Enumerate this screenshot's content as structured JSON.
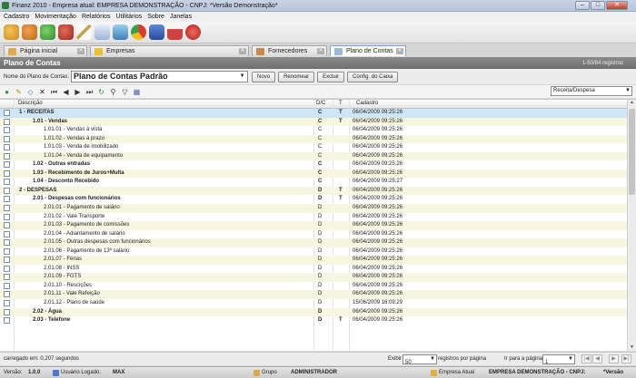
{
  "window": {
    "title": "Finanz 2010 - Empresa atual: EMPRESA DEMONSTRAÇÃO - CNPJ: *Versão Demonstração*",
    "minimize": "–",
    "maximize": "□",
    "close": "✕"
  },
  "menu": [
    "Cadastro",
    "Movimentação",
    "Relatórios",
    "Utilitários",
    "Sobre",
    "Janelas"
  ],
  "toolbar_icons": [
    "users-icon",
    "people-icon",
    "money-icon",
    "cash-icon",
    "pen-icon",
    "report-icon",
    "chart-icon",
    "pie-icon",
    "save-icon",
    "calendar-icon",
    "power-icon"
  ],
  "tabs": [
    {
      "label": "Página inicial",
      "icon": "home-icon",
      "active": false
    },
    {
      "label": "Empresas",
      "icon": "star-icon",
      "active": false
    },
    {
      "label": "Fornecedores",
      "icon": "box-icon",
      "active": false
    },
    {
      "label": "Plano de Contas",
      "icon": "document-icon",
      "active": true
    }
  ],
  "header": {
    "title": "Plano de Contas",
    "count": "1-50/84 registros"
  },
  "form": {
    "label": "Nome do Plano de Contas:",
    "value": "Plano de Contas Padrão",
    "buttons": [
      "Novo",
      "Renomear",
      "Excluir",
      "Config. do Caixa"
    ]
  },
  "actions": {
    "icons": [
      "add-icon",
      "edit-icon",
      "erase-icon",
      "delete-icon",
      "first-icon",
      "prev-icon",
      "next-icon",
      "last-icon",
      "refresh-icon",
      "search-icon",
      "filter-icon",
      "grid-icon"
    ],
    "type_select": "Receita/Despesa"
  },
  "grid": {
    "columns": {
      "descricao": "Descrição",
      "dc": "D/C",
      "t": "T",
      "cadastro": "Cadastro"
    },
    "rows": [
      {
        "desc": "1 - RECEITAS",
        "dc": "C",
        "t": "T",
        "cad": "06/04/2009 09:25:26",
        "level": 0
      },
      {
        "desc": "1.01 - Vendas",
        "dc": "C",
        "t": "T",
        "cad": "06/04/2009 09:25:26",
        "level": 1
      },
      {
        "desc": "1.01.01 - Vendas à vista",
        "dc": "C",
        "t": "",
        "cad": "06/04/2009 09:25:26",
        "level": 2
      },
      {
        "desc": "1.01.02 - Vendas à prazo",
        "dc": "C",
        "t": "",
        "cad": "06/04/2009 09:25:26",
        "level": 2
      },
      {
        "desc": "1.01.03 - Venda de imobilizado",
        "dc": "C",
        "t": "",
        "cad": "06/04/2009 09:25:26",
        "level": 2
      },
      {
        "desc": "1.01.04 - Venda de equipamento",
        "dc": "C",
        "t": "",
        "cad": "06/04/2009 09:25:26",
        "level": 2
      },
      {
        "desc": "1.02 - Outras entradas",
        "dc": "C",
        "t": "",
        "cad": "06/04/2009 09:25:26",
        "level": 1
      },
      {
        "desc": "1.03 - Recebimento de Juros+Multa",
        "dc": "C",
        "t": "",
        "cad": "06/04/2009 09:25:26",
        "level": 1
      },
      {
        "desc": "1.04 - Desconto Recebido",
        "dc": "C",
        "t": "",
        "cad": "06/04/2009 09:25:27",
        "level": 1
      },
      {
        "desc": "2 - DESPESAS",
        "dc": "D",
        "t": "T",
        "cad": "06/04/2009 09:25:26",
        "level": 0
      },
      {
        "desc": "2.01 - Despesas com funcionários",
        "dc": "D",
        "t": "T",
        "cad": "06/04/2009 09:25:26",
        "level": 1
      },
      {
        "desc": "2.01.01 - Pagamento de salário",
        "dc": "D",
        "t": "",
        "cad": "06/04/2009 09:25:26",
        "level": 2
      },
      {
        "desc": "2.01.02 - Vale Transporte",
        "dc": "D",
        "t": "",
        "cad": "06/04/2009 09:25:26",
        "level": 2
      },
      {
        "desc": "2.01.03 - Pagamento de comissões",
        "dc": "D",
        "t": "",
        "cad": "06/04/2009 09:25:26",
        "level": 2
      },
      {
        "desc": "2.01.04 - Adiantamento de salário",
        "dc": "D",
        "t": "",
        "cad": "06/04/2009 09:25:26",
        "level": 2
      },
      {
        "desc": "2.01.05 - Outras despesas com funcionários",
        "dc": "D",
        "t": "",
        "cad": "06/04/2009 09:25:26",
        "level": 2
      },
      {
        "desc": "2.01.06 - Pagamento de 13º salário",
        "dc": "D",
        "t": "",
        "cad": "06/04/2009 09:25:26",
        "level": 2
      },
      {
        "desc": "2.01.07 - Férias",
        "dc": "D",
        "t": "",
        "cad": "06/04/2009 09:25:26",
        "level": 2
      },
      {
        "desc": "2.01.08 - INSS",
        "dc": "D",
        "t": "",
        "cad": "06/04/2009 09:25:26",
        "level": 2
      },
      {
        "desc": "2.01.09 - FGTS",
        "dc": "D",
        "t": "",
        "cad": "06/04/2009 09:25:26",
        "level": 2
      },
      {
        "desc": "2.01.10 - Rescições",
        "dc": "D",
        "t": "",
        "cad": "06/04/2009 09:25:26",
        "level": 2
      },
      {
        "desc": "2.01.11 - Vale Refeição",
        "dc": "D",
        "t": "",
        "cad": "06/04/2009 09:25:26",
        "level": 2
      },
      {
        "desc": "2.01.12 - Plano de saúde",
        "dc": "D",
        "t": "",
        "cad": "15/06/2009 16:09:29",
        "level": 2
      },
      {
        "desc": "2.02 - Água",
        "dc": "D",
        "t": "",
        "cad": "06/04/2009 09:25:26",
        "level": 1
      },
      {
        "desc": "2.03 - Telefone",
        "dc": "D",
        "t": "T",
        "cad": "06/04/2009 09:25:26",
        "level": 1
      }
    ]
  },
  "pager": {
    "exibir_label": "Exibir",
    "per_page": "50",
    "per_page_label": "registros por página",
    "goto_label": "Ir para a página",
    "page": "1",
    "load_status": "carregado em: 0,207 segundos"
  },
  "status": {
    "versao_label": "Versão:",
    "versao": "1.0.0",
    "usuario_label": "Usuário Logado:",
    "usuario": "MAX",
    "grupo_label": "Grupo",
    "grupo": "ADMINISTRADOR",
    "empresa_label": "Empresa Atual",
    "empresa": "EMPRESA DEMONSTRAÇÃO - CNPJ:",
    "versao_demo": "*Versão"
  }
}
